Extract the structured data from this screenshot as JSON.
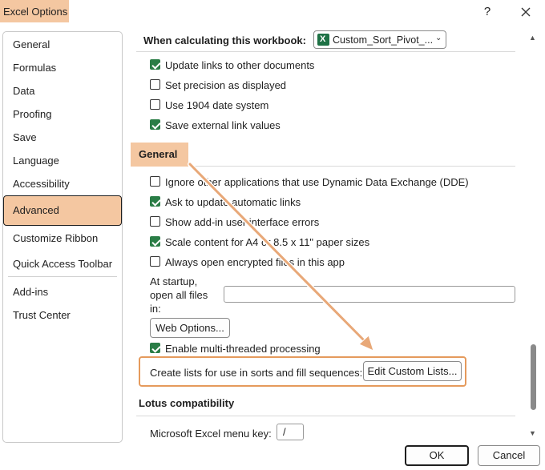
{
  "window": {
    "title": "Excel Options",
    "help_label": "?"
  },
  "nav": {
    "items": [
      {
        "label": "General"
      },
      {
        "label": "Formulas"
      },
      {
        "label": "Data"
      },
      {
        "label": "Proofing"
      },
      {
        "label": "Save"
      },
      {
        "label": "Language"
      },
      {
        "label": "Accessibility"
      },
      {
        "label": "Advanced",
        "selected": true
      },
      {
        "label": "Customize Ribbon"
      },
      {
        "label": "Quick Access Toolbar"
      },
      {
        "label": "Add-ins"
      },
      {
        "label": "Trust Center"
      }
    ]
  },
  "calc_section": {
    "label": "When calculating this workbook:",
    "workbook_select": "Custom_Sort_Pivot_...",
    "options": [
      {
        "label": "Update links to other documents",
        "checked": true
      },
      {
        "label": "Set precision as displayed",
        "checked": false
      },
      {
        "label": "Use 1904 date system",
        "checked": false
      },
      {
        "label": "Save external link values",
        "checked": true
      }
    ]
  },
  "general_section": {
    "label": "General",
    "options": [
      {
        "label": "Ignore other applications that use Dynamic Data Exchange (DDE)",
        "checked": false
      },
      {
        "label": "Ask to update automatic links",
        "checked": true
      },
      {
        "label": "Show add-in user interface errors",
        "checked": false
      },
      {
        "label": "Scale content for A4 or 8.5 x 11\" paper sizes",
        "checked": true
      },
      {
        "label": "Always open encrypted files in this app",
        "checked": false
      }
    ],
    "startup_label_1": "At startup,",
    "startup_label_2": "open all files",
    "startup_label_3": "in:",
    "startup_value": "",
    "web_options_label": "Web Options...",
    "multithread": {
      "label": "Enable multi-threaded processing",
      "checked": true
    },
    "custom_lists_text": "Create lists for use in sorts and fill sequences:",
    "custom_lists_button": "Edit Custom Lists..."
  },
  "lotus_section": {
    "label": "Lotus compatibility",
    "menu_key_label": "Microsoft Excel menu key:",
    "menu_key_value": "/"
  },
  "footer": {
    "ok_label": "OK",
    "cancel_label": "Cancel"
  },
  "colors": {
    "highlight": "#f4c7a1",
    "accent_border": "#e59a5c",
    "checkbox_green": "#2a7d46",
    "excel_green": "#1e7145"
  },
  "icons": [
    "close-icon",
    "excel-file-icon",
    "chevron-down-icon",
    "scroll-up-icon",
    "scroll-down-icon",
    "annotation-arrow"
  ]
}
